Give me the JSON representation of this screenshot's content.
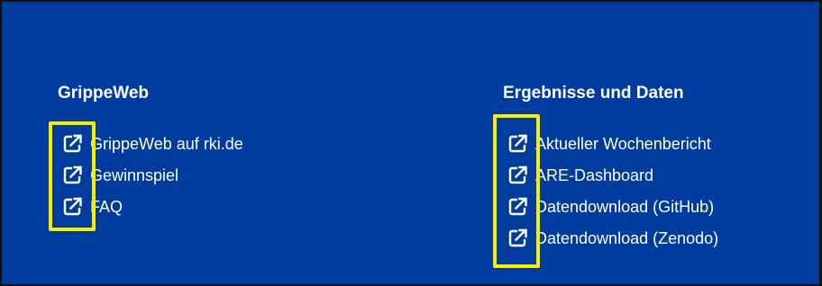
{
  "colors": {
    "background": "#003c9e",
    "text": "#ffffff",
    "highlight": "#f6f000"
  },
  "sections": [
    {
      "heading": "GrippeWeb",
      "links": [
        {
          "label": "GrippeWeb auf rki.de",
          "icon": "external-link-icon"
        },
        {
          "label": "Gewinnspiel",
          "icon": "external-link-icon"
        },
        {
          "label": "FAQ",
          "icon": "external-link-icon"
        }
      ]
    },
    {
      "heading": "Ergebnisse und Daten",
      "links": [
        {
          "label": "Aktueller Wochenbericht",
          "icon": "external-link-icon"
        },
        {
          "label": "ARE-Dashboard",
          "icon": "external-link-icon"
        },
        {
          "label": "Datendownload (GitHub)",
          "icon": "external-link-icon"
        },
        {
          "label": "Datendownload (Zenodo)",
          "icon": "external-link-icon"
        }
      ]
    }
  ]
}
